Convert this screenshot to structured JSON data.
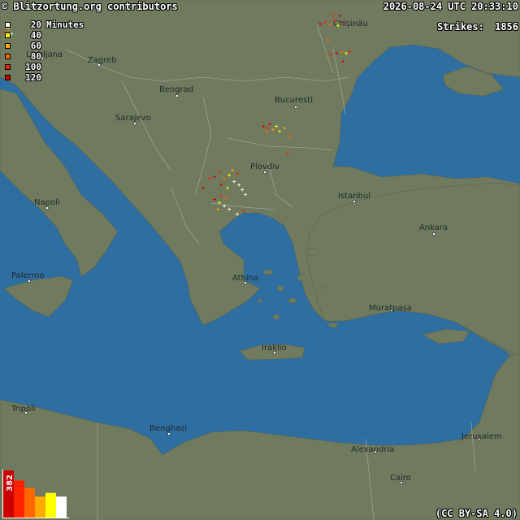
{
  "header": {
    "credit": "© Blitzortung.org contributors",
    "timestamp": "2026-08-24 UTC 20:33:10",
    "strikes_label": "Strikes:",
    "strikes_count": "1856"
  },
  "legend": {
    "items": [
      {
        "label": "20",
        "suffix": "Minutes",
        "color": "#ffffff"
      },
      {
        "label": "40",
        "color": "#ffff00"
      },
      {
        "label": "60",
        "color": "#ffaa00"
      },
      {
        "label": "80",
        "color": "#ff6600"
      },
      {
        "label": "100",
        "color": "#ff2200"
      },
      {
        "label": "120",
        "color": "#cc0000"
      }
    ]
  },
  "license": "(CC BY-SA 4.0)",
  "colors": {
    "sea": "#2e6ea0",
    "land": "#6f7a5f",
    "border": "#a8aca0"
  },
  "cities": [
    {
      "name": "Ljubljana"
    },
    {
      "name": "Zagreb"
    },
    {
      "name": "Beograd"
    },
    {
      "name": "Sarajevo"
    },
    {
      "name": "Bucuresti"
    },
    {
      "name": "Plovdiv"
    },
    {
      "name": "Istanbul"
    },
    {
      "name": "Ankara"
    },
    {
      "name": "Napoli"
    },
    {
      "name": "Palermo"
    },
    {
      "name": "Athína"
    },
    {
      "name": "Muratpasa"
    },
    {
      "name": "Iraklio"
    },
    {
      "name": "Tripoli"
    },
    {
      "name": "Benghazi"
    },
    {
      "name": "Alexandria"
    },
    {
      "name": "Cairo"
    },
    {
      "name": "Jerusalem"
    },
    {
      "name": "Chișinău"
    }
  ],
  "histogram": {
    "peak_label": "382",
    "values": [
      382,
      300,
      240,
      170,
      200,
      170
    ],
    "colors": [
      "#cc0000",
      "#ff2200",
      "#ff6600",
      "#ffaa00",
      "#ffff00",
      "#ffffff"
    ]
  }
}
